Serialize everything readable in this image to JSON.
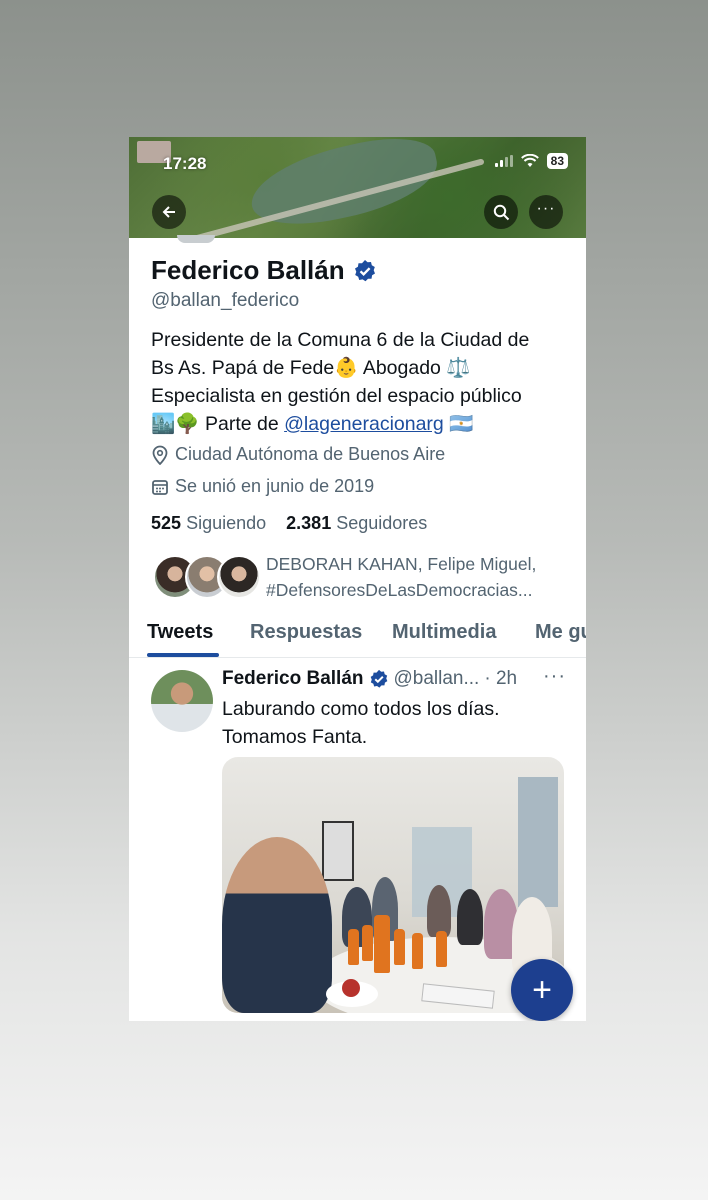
{
  "status_bar": {
    "time": "17:28",
    "battery": "83"
  },
  "profile": {
    "name": "Federico Ballán",
    "handle": "@ballan_federico",
    "bio_line1": "Presidente de la Comuna 6 de la Ciudad de",
    "bio_line2": "Bs As. Papá de Fede👶 Abogado ⚖️",
    "bio_line3": "Especialista en gestión del espacio público",
    "bio_line4_prefix": "🏙️🌳 Parte de ",
    "bio_link": "@lageneracionarg",
    "bio_line4_suffix": " 🇦🇷",
    "location": "Ciudad Autónoma de Buenos Aire",
    "joined": "Se unió en junio de 2019",
    "following_count": "525",
    "following_label": "Siguiendo",
    "followers_count": "2.381",
    "followers_label": "Seguidores",
    "followed_by_line1": "DEBORAH KAHAN, Felipe Miguel,",
    "followed_by_line2": "#DefensoresDeLasDemocracias..."
  },
  "tabs": [
    {
      "label": "Tweets"
    },
    {
      "label": "Respuestas"
    },
    {
      "label": "Multimedia"
    },
    {
      "label": "Me gusta"
    }
  ],
  "tweet": {
    "author": "Federico Ballán",
    "handle": "@ballan...",
    "time": "· 2h",
    "more": "···",
    "text_line1": "Laburando como todos los días.",
    "text_line2": "Tomamos Fanta."
  },
  "fab_label": "+",
  "colors": {
    "accent": "#1d4d9e",
    "verified": "#1d4d9e",
    "fab": "#1d3f8f"
  }
}
